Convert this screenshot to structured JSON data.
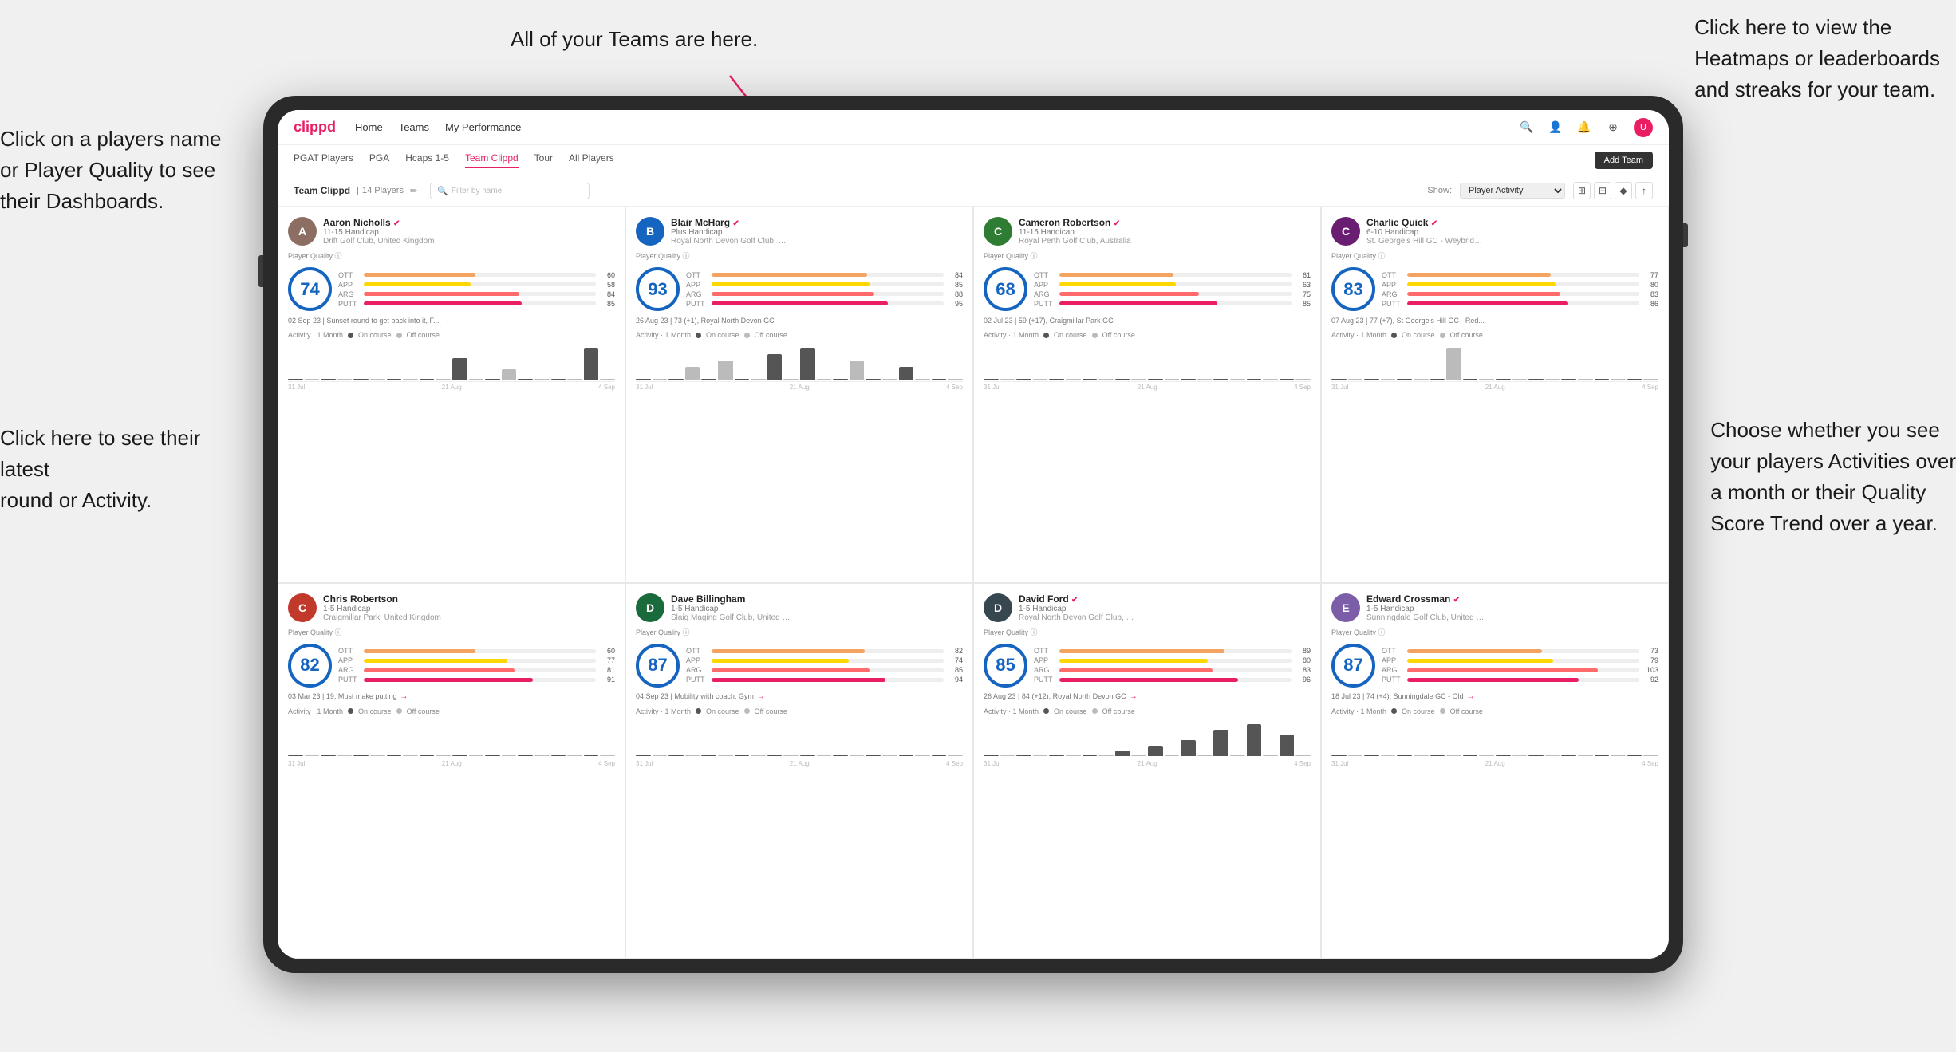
{
  "annotations": {
    "top_center": "All of your Teams are here.",
    "top_right": "Click here to view the\nHeatmaps or leaderboards\nand streaks for your team.",
    "left_top": "Click on a players name\nor Player Quality to see\ntheir Dashboards.",
    "left_bottom": "Click here to see their latest\nround or Activity.",
    "right_bottom": "Choose whether you see\nyour players Activities over\na month or their Quality\nScore Trend over a year."
  },
  "nav": {
    "logo": "clippd",
    "links": [
      "Home",
      "Teams",
      "My Performance"
    ],
    "icons": [
      "🔍",
      "👤",
      "🔔",
      "⊕",
      "👤"
    ]
  },
  "sub_nav": {
    "tabs": [
      "PGAT Players",
      "PGA",
      "Hcaps 1-5",
      "Team Clippd",
      "Tour",
      "All Players"
    ],
    "active_tab": "Team Clippd",
    "add_button": "Add Team"
  },
  "team_header": {
    "title": "Team Clippd",
    "count": "14 Players",
    "search_placeholder": "Filter by name",
    "show_label": "Show:",
    "show_option": "Player Activity",
    "view_options": [
      "⊞",
      "⊟",
      "♦",
      "↑"
    ]
  },
  "players": [
    {
      "name": "Aaron Nicholls",
      "handicap": "11-15 Handicap",
      "club": "Drift Golf Club, United Kingdom",
      "quality": 74,
      "ott": 60,
      "app": 58,
      "arg": 84,
      "putt": 85,
      "recent": "02 Sep 23 | Sunset round to get back into it, F...",
      "avatar_color": "#8d6e63",
      "avatar_letter": "A",
      "chart_data": [
        0,
        0,
        0,
        0,
        0,
        0,
        0,
        0,
        0,
        0,
        2,
        0,
        0,
        1,
        0,
        0,
        0,
        0,
        3,
        0
      ],
      "chart_labels": [
        "31 Jul",
        "21 Aug",
        "4 Sep"
      ]
    },
    {
      "name": "Blair McHarg",
      "handicap": "Plus Handicap",
      "club": "Royal North Devon Golf Club, United Kin...",
      "quality": 93,
      "ott": 84,
      "app": 85,
      "arg": 88,
      "putt": 95,
      "recent": "26 Aug 23 | 73 (+1), Royal North Devon GC",
      "avatar_color": "#1565c0",
      "avatar_letter": "B",
      "chart_data": [
        0,
        0,
        0,
        2,
        0,
        3,
        0,
        0,
        4,
        0,
        5,
        0,
        0,
        3,
        0,
        0,
        2,
        0,
        0,
        0
      ],
      "chart_labels": [
        "31 Jul",
        "21 Aug",
        "4 Sep"
      ]
    },
    {
      "name": "Cameron Robertson",
      "handicap": "11-15 Handicap",
      "club": "Royal Perth Golf Club, Australia",
      "quality": 68,
      "ott": 61,
      "app": 63,
      "arg": 75,
      "putt": 85,
      "recent": "02 Jul 23 | 59 (+17), Craigmillar Park GC",
      "avatar_color": "#2e7d32",
      "avatar_letter": "C",
      "chart_data": [
        0,
        0,
        0,
        0,
        0,
        0,
        0,
        0,
        0,
        0,
        0,
        0,
        0,
        0,
        0,
        0,
        0,
        0,
        0,
        0
      ],
      "chart_labels": [
        "31 Jul",
        "21 Aug",
        "4 Sep"
      ]
    },
    {
      "name": "Charlie Quick",
      "handicap": "6-10 Handicap",
      "club": "St. George's Hill GC - Weybridge - Surrey...",
      "quality": 83,
      "ott": 77,
      "app": 80,
      "arg": 83,
      "putt": 86,
      "recent": "07 Aug 23 | 77 (+7), St George's Hill GC - Red...",
      "avatar_color": "#6a1e72",
      "avatar_letter": "C",
      "chart_data": [
        0,
        0,
        0,
        0,
        0,
        0,
        0,
        2,
        0,
        0,
        0,
        0,
        0,
        0,
        0,
        0,
        0,
        0,
        0,
        0
      ],
      "chart_labels": [
        "31 Jul",
        "21 Aug",
        "4 Sep"
      ]
    },
    {
      "name": "Chris Robertson",
      "handicap": "1-5 Handicap",
      "club": "Craigmillar Park, United Kingdom",
      "quality": 82,
      "ott": 60,
      "app": 77,
      "arg": 81,
      "putt": 91,
      "recent": "03 Mar 23 | 19, Must make putting",
      "avatar_color": "#c0392b",
      "avatar_letter": "C",
      "chart_data": [
        0,
        0,
        0,
        0,
        0,
        0,
        0,
        0,
        0,
        0,
        0,
        0,
        0,
        0,
        0,
        0,
        0,
        0,
        0,
        0
      ],
      "chart_labels": [
        "31 Jul",
        "21 Aug",
        "4 Sep"
      ]
    },
    {
      "name": "Dave Billingham",
      "handicap": "1-5 Handicap",
      "club": "Slaig Maging Golf Club, United Kingdom",
      "quality": 87,
      "ott": 82,
      "app": 74,
      "arg": 85,
      "putt": 94,
      "recent": "04 Sep 23 | Mobility with coach, Gym",
      "avatar_color": "#1a6b3c",
      "avatar_letter": "D",
      "chart_data": [
        0,
        0,
        0,
        0,
        0,
        0,
        0,
        0,
        0,
        0,
        0,
        0,
        0,
        0,
        0,
        0,
        0,
        0,
        0,
        0
      ],
      "chart_labels": [
        "31 Jul",
        "21 Aug",
        "4 Sep"
      ]
    },
    {
      "name": "David Ford",
      "handicap": "1-5 Handicap",
      "club": "Royal North Devon Golf Club, United Kin...",
      "quality": 85,
      "ott": 89,
      "app": 80,
      "arg": 83,
      "putt": 96,
      "recent": "26 Aug 23 | 84 (+12), Royal North Devon GC",
      "avatar_color": "#37474f",
      "avatar_letter": "D",
      "chart_data": [
        0,
        0,
        0,
        0,
        0,
        0,
        0,
        0,
        1,
        0,
        2,
        0,
        3,
        0,
        5,
        0,
        6,
        0,
        4,
        0
      ],
      "chart_labels": [
        "31 Jul",
        "21 Aug",
        "4 Sep"
      ]
    },
    {
      "name": "Edward Crossman",
      "handicap": "1-5 Handicap",
      "club": "Sunningdale Golf Club, United Kingdom",
      "quality": 87,
      "ott": 73,
      "app": 79,
      "arg": 103,
      "putt": 92,
      "recent": "18 Jul 23 | 74 (+4), Sunningdale GC - Old",
      "avatar_color": "#7b5ea7",
      "avatar_letter": "E",
      "chart_data": [
        0,
        0,
        0,
        0,
        0,
        0,
        0,
        0,
        0,
        0,
        0,
        0,
        0,
        0,
        0,
        0,
        0,
        0,
        0,
        0
      ],
      "chart_labels": [
        "31 Jul",
        "21 Aug",
        "4 Sep"
      ]
    }
  ],
  "bar_colors": {
    "ott": "#f4a460",
    "app": "#ffd700",
    "arg": "#ff6b6b",
    "putt": "#e91e63"
  },
  "activity_labels": {
    "period": "Activity · 1 Month",
    "on_course": "On course",
    "off_course": "Off course",
    "on_color": "#555",
    "off_color": "#aaa"
  }
}
